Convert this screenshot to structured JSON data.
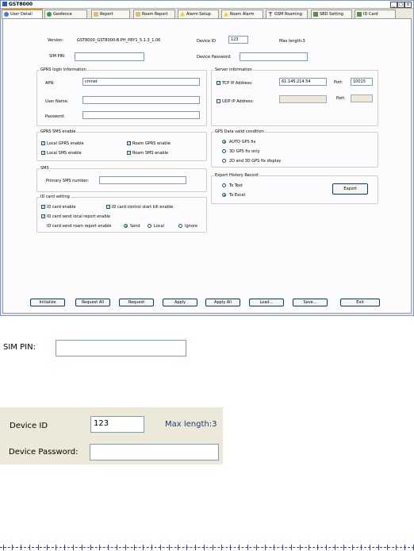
{
  "window": {
    "title": "GST8000",
    "controls": [
      "_",
      "□",
      "×"
    ]
  },
  "tabs": [
    {
      "label": "User Detail",
      "icon": "user-icon",
      "active": true
    },
    {
      "label": "Geofence",
      "icon": "globe-icon",
      "active": false
    },
    {
      "label": "Report",
      "icon": "report-icon",
      "active": false
    },
    {
      "label": "Roam Report",
      "icon": "report-icon",
      "active": false
    },
    {
      "label": "Alarm Setup",
      "icon": "warning-icon",
      "active": false
    },
    {
      "label": "Roam Alarm",
      "icon": "warning-icon",
      "active": false
    },
    {
      "label": "GSM Roaming",
      "icon": "antenna-icon",
      "active": false
    },
    {
      "label": "SBD Setting",
      "icon": "sbd-icon",
      "active": false
    },
    {
      "label": "ID Card",
      "icon": "card-icon",
      "active": false
    }
  ],
  "top": {
    "version_label": "Version:",
    "version_value": "GST8000_GST8000-B.PH_P8Y1_5.1.3_1.06",
    "sim_pin_label": "SIM PIN:",
    "sim_pin_value": "",
    "device_id_label": "Device ID",
    "device_id_value": "123",
    "max_length_label": "Max length:3",
    "device_password_label": "Device Password:",
    "device_password_value": ""
  },
  "gprs_login": {
    "title": "GPRS login information",
    "apn_label": "APN:",
    "apn_value": "cmnet",
    "user_label": "User Name:",
    "user_value": "",
    "password_label": "Password:",
    "password_value": ""
  },
  "server": {
    "title": "Server information",
    "tcp_label": "TCP IP Address:",
    "tcp_checked": true,
    "tcp_value": "61.145.214.54",
    "tcp_port_label": "Port:",
    "tcp_port_value": "10015",
    "udp_label": "UDP IP Address:",
    "udp_checked": false,
    "udp_value": "",
    "udp_port_label": "Port:",
    "udp_port_value": ""
  },
  "gprs_sms": {
    "title": "GPRS SMS enable",
    "local_gprs": "Local GPRS enable",
    "roam_gprs": "Roam GPRS enable",
    "local_sms": "Local SMS enable",
    "roam_sms": "Roam SMS enable"
  },
  "gps_valid": {
    "title": "GPS Data valid condition",
    "opt1": "AUTO GPS fix",
    "opt2": "3D GPS fix only",
    "opt3": "2D and 3D GPS fix display",
    "selected": 0
  },
  "sms": {
    "title": "SMS",
    "primary_label": "Primary SMS number:",
    "primary_value": ""
  },
  "export": {
    "title": "Export History Record",
    "to_text": "To Text",
    "to_excel": "To Excel",
    "selected": "excel",
    "button": "Export"
  },
  "id_card": {
    "title": "ID card setting",
    "enable": "ID card enable",
    "control": "ID card control start kill enable",
    "send_local": "ID card send local report enable",
    "roam_label": "ID card send roam report enable",
    "opt_send": "Send",
    "opt_local": "Local",
    "opt_ignore": "Ignore",
    "selected": "send"
  },
  "buttons": [
    "Initialize",
    "Request All",
    "Request",
    "Apply",
    "Apply All",
    "Load...",
    "Save...",
    "Exit"
  ],
  "colors": {
    "window_bg": "#ece9d8",
    "panel_bg": "#fcfcfe",
    "input_border": "#7f9db9",
    "check_color": "#21a121",
    "tab_active": "#e68b2c",
    "dash_color": "#3a3ab0"
  }
}
